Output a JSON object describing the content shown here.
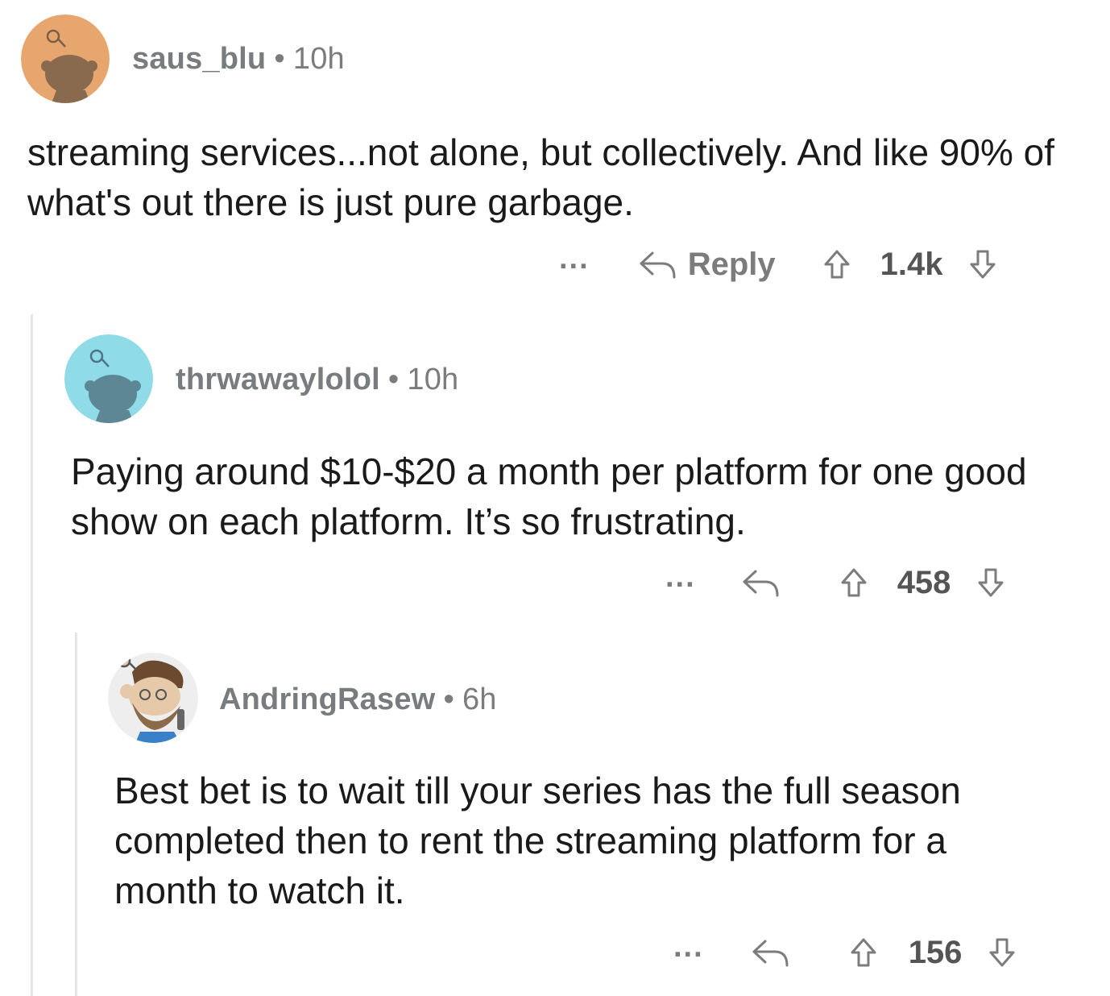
{
  "comments": [
    {
      "user": "saus_blu",
      "time": "10h",
      "body": "streaming services...not alone, but collectively. And like 90% of what's out there is just pure garbage.",
      "more": "...",
      "reply_label": "Reply",
      "score": "1.4k",
      "avatar_bg": "#e8a66f",
      "avatar_fg": "#8a6a4e"
    },
    {
      "user": "thrwawaylolol",
      "time": "10h",
      "body": "Paying around $10-$20 a month per platform for one good show on each platform. It’s so frustrating.",
      "more": "...",
      "score": "458",
      "avatar_bg": "#8fdbe8",
      "avatar_fg": "#5d8794"
    },
    {
      "user": "AndringRasew",
      "time": "6h",
      "body": "Best bet is to wait till your series has the full season completed then to rent the streaming platform for a month to watch it.",
      "more": "...",
      "score": "156",
      "avatar_bg": "#eeeeee",
      "avatar_fg": "#8b6a4a"
    }
  ],
  "separator": "•",
  "icons": [
    "reddit-snoo-avatar-icon",
    "reply-arrow-icon",
    "upvote-arrow-icon",
    "downvote-arrow-icon"
  ],
  "colors": {
    "meta": "#7c7c7c",
    "text": "#1a1a1b",
    "thread_line": "#e6e6e6"
  }
}
